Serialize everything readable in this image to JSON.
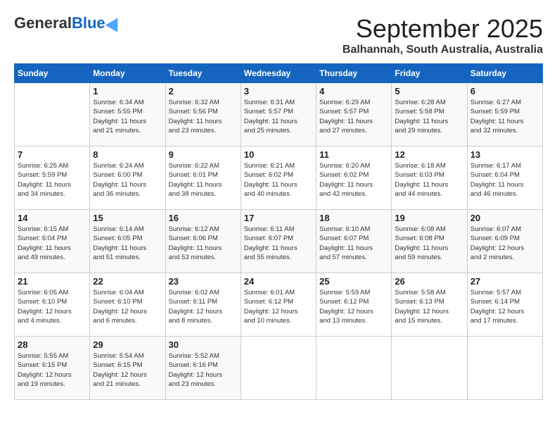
{
  "header": {
    "logo": {
      "general": "General",
      "blue": "Blue"
    },
    "title": "September 2025",
    "location": "Balhannah, South Australia, Australia"
  },
  "weekdays": [
    "Sunday",
    "Monday",
    "Tuesday",
    "Wednesday",
    "Thursday",
    "Friday",
    "Saturday"
  ],
  "weeks": [
    [
      {
        "day": "",
        "sunrise": "",
        "sunset": "",
        "daylight": ""
      },
      {
        "day": "1",
        "sunrise": "Sunrise: 6:34 AM",
        "sunset": "Sunset: 5:55 PM",
        "daylight": "Daylight: 11 hours and 21 minutes."
      },
      {
        "day": "2",
        "sunrise": "Sunrise: 6:32 AM",
        "sunset": "Sunset: 5:56 PM",
        "daylight": "Daylight: 11 hours and 23 minutes."
      },
      {
        "day": "3",
        "sunrise": "Sunrise: 6:31 AM",
        "sunset": "Sunset: 5:57 PM",
        "daylight": "Daylight: 11 hours and 25 minutes."
      },
      {
        "day": "4",
        "sunrise": "Sunrise: 6:29 AM",
        "sunset": "Sunset: 5:57 PM",
        "daylight": "Daylight: 11 hours and 27 minutes."
      },
      {
        "day": "5",
        "sunrise": "Sunrise: 6:28 AM",
        "sunset": "Sunset: 5:58 PM",
        "daylight": "Daylight: 11 hours and 29 minutes."
      },
      {
        "day": "6",
        "sunrise": "Sunrise: 6:27 AM",
        "sunset": "Sunset: 5:59 PM",
        "daylight": "Daylight: 11 hours and 32 minutes."
      }
    ],
    [
      {
        "day": "7",
        "sunrise": "Sunrise: 6:25 AM",
        "sunset": "Sunset: 5:59 PM",
        "daylight": "Daylight: 11 hours and 34 minutes."
      },
      {
        "day": "8",
        "sunrise": "Sunrise: 6:24 AM",
        "sunset": "Sunset: 6:00 PM",
        "daylight": "Daylight: 11 hours and 36 minutes."
      },
      {
        "day": "9",
        "sunrise": "Sunrise: 6:22 AM",
        "sunset": "Sunset: 6:01 PM",
        "daylight": "Daylight: 11 hours and 38 minutes."
      },
      {
        "day": "10",
        "sunrise": "Sunrise: 6:21 AM",
        "sunset": "Sunset: 6:02 PM",
        "daylight": "Daylight: 11 hours and 40 minutes."
      },
      {
        "day": "11",
        "sunrise": "Sunrise: 6:20 AM",
        "sunset": "Sunset: 6:02 PM",
        "daylight": "Daylight: 11 hours and 42 minutes."
      },
      {
        "day": "12",
        "sunrise": "Sunrise: 6:18 AM",
        "sunset": "Sunset: 6:03 PM",
        "daylight": "Daylight: 11 hours and 44 minutes."
      },
      {
        "day": "13",
        "sunrise": "Sunrise: 6:17 AM",
        "sunset": "Sunset: 6:04 PM",
        "daylight": "Daylight: 11 hours and 46 minutes."
      }
    ],
    [
      {
        "day": "14",
        "sunrise": "Sunrise: 6:15 AM",
        "sunset": "Sunset: 6:04 PM",
        "daylight": "Daylight: 11 hours and 49 minutes."
      },
      {
        "day": "15",
        "sunrise": "Sunrise: 6:14 AM",
        "sunset": "Sunset: 6:05 PM",
        "daylight": "Daylight: 11 hours and 51 minutes."
      },
      {
        "day": "16",
        "sunrise": "Sunrise: 6:12 AM",
        "sunset": "Sunset: 6:06 PM",
        "daylight": "Daylight: 11 hours and 53 minutes."
      },
      {
        "day": "17",
        "sunrise": "Sunrise: 6:11 AM",
        "sunset": "Sunset: 6:07 PM",
        "daylight": "Daylight: 11 hours and 55 minutes."
      },
      {
        "day": "18",
        "sunrise": "Sunrise: 6:10 AM",
        "sunset": "Sunset: 6:07 PM",
        "daylight": "Daylight: 11 hours and 57 minutes."
      },
      {
        "day": "19",
        "sunrise": "Sunrise: 6:08 AM",
        "sunset": "Sunset: 6:08 PM",
        "daylight": "Daylight: 11 hours and 59 minutes."
      },
      {
        "day": "20",
        "sunrise": "Sunrise: 6:07 AM",
        "sunset": "Sunset: 6:09 PM",
        "daylight": "Daylight: 12 hours and 2 minutes."
      }
    ],
    [
      {
        "day": "21",
        "sunrise": "Sunrise: 6:05 AM",
        "sunset": "Sunset: 6:10 PM",
        "daylight": "Daylight: 12 hours and 4 minutes."
      },
      {
        "day": "22",
        "sunrise": "Sunrise: 6:04 AM",
        "sunset": "Sunset: 6:10 PM",
        "daylight": "Daylight: 12 hours and 6 minutes."
      },
      {
        "day": "23",
        "sunrise": "Sunrise: 6:02 AM",
        "sunset": "Sunset: 6:11 PM",
        "daylight": "Daylight: 12 hours and 8 minutes."
      },
      {
        "day": "24",
        "sunrise": "Sunrise: 6:01 AM",
        "sunset": "Sunset: 6:12 PM",
        "daylight": "Daylight: 12 hours and 10 minutes."
      },
      {
        "day": "25",
        "sunrise": "Sunrise: 5:59 AM",
        "sunset": "Sunset: 6:12 PM",
        "daylight": "Daylight: 12 hours and 13 minutes."
      },
      {
        "day": "26",
        "sunrise": "Sunrise: 5:58 AM",
        "sunset": "Sunset: 6:13 PM",
        "daylight": "Daylight: 12 hours and 15 minutes."
      },
      {
        "day": "27",
        "sunrise": "Sunrise: 5:57 AM",
        "sunset": "Sunset: 6:14 PM",
        "daylight": "Daylight: 12 hours and 17 minutes."
      }
    ],
    [
      {
        "day": "28",
        "sunrise": "Sunrise: 5:55 AM",
        "sunset": "Sunset: 6:15 PM",
        "daylight": "Daylight: 12 hours and 19 minutes."
      },
      {
        "day": "29",
        "sunrise": "Sunrise: 5:54 AM",
        "sunset": "Sunset: 6:15 PM",
        "daylight": "Daylight: 12 hours and 21 minutes."
      },
      {
        "day": "30",
        "sunrise": "Sunrise: 5:52 AM",
        "sunset": "Sunset: 6:16 PM",
        "daylight": "Daylight: 12 hours and 23 minutes."
      },
      {
        "day": "",
        "sunrise": "",
        "sunset": "",
        "daylight": ""
      },
      {
        "day": "",
        "sunrise": "",
        "sunset": "",
        "daylight": ""
      },
      {
        "day": "",
        "sunrise": "",
        "sunset": "",
        "daylight": ""
      },
      {
        "day": "",
        "sunrise": "",
        "sunset": "",
        "daylight": ""
      }
    ]
  ]
}
